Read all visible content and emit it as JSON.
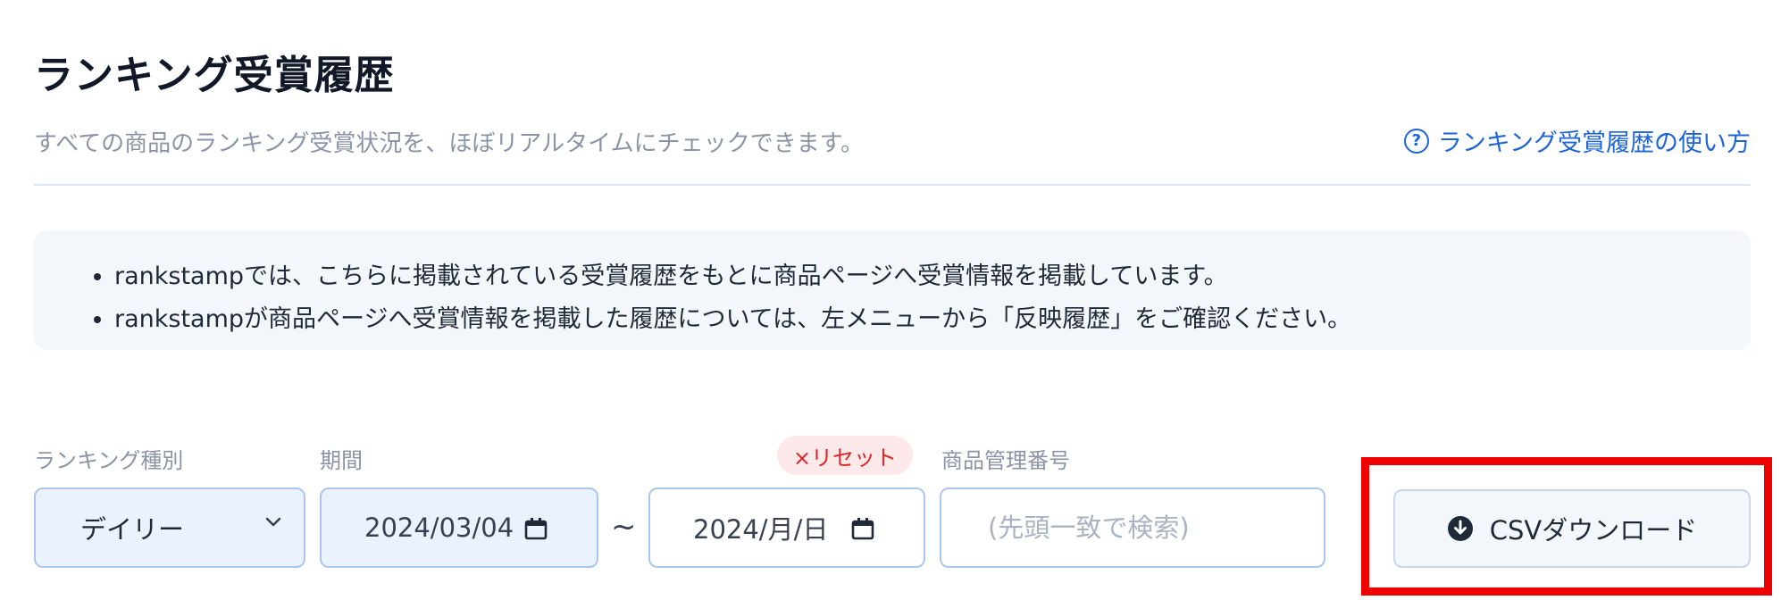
{
  "header": {
    "title": "ランキング受賞履歴",
    "subtitle": "すべての商品のランキング受賞状況を、ほぼリアルタイムにチェックできます。",
    "help_link": "ランキング受賞履歴の使い方"
  },
  "info": {
    "items": [
      "rankstampでは、こちらに掲載されている受賞履歴をもとに商品ページへ受賞情報を掲載しています。",
      "rankstampが商品ページへ受賞情報を掲載した履歴については、左メニューから「反映履歴」をご確認ください。"
    ]
  },
  "filters": {
    "ranking_type": {
      "label": "ランキング種別",
      "value": "デイリー"
    },
    "period": {
      "label": "期間",
      "from": "2024/03/04",
      "to": "2024/月/日",
      "separator": "~",
      "reset": "×リセット"
    },
    "product_code": {
      "label": "商品管理番号",
      "placeholder": "(先頭一致で検索)"
    }
  },
  "actions": {
    "csv_download": "CSVダウンロード"
  },
  "colors": {
    "accent": "#1d64d8",
    "highlight": "#ee0000",
    "reset": "#dc2626"
  },
  "icons": {
    "help": "question-circle-icon",
    "calendar": "calendar-icon",
    "chevron": "chevron-down-icon",
    "download": "download-circle-icon"
  }
}
